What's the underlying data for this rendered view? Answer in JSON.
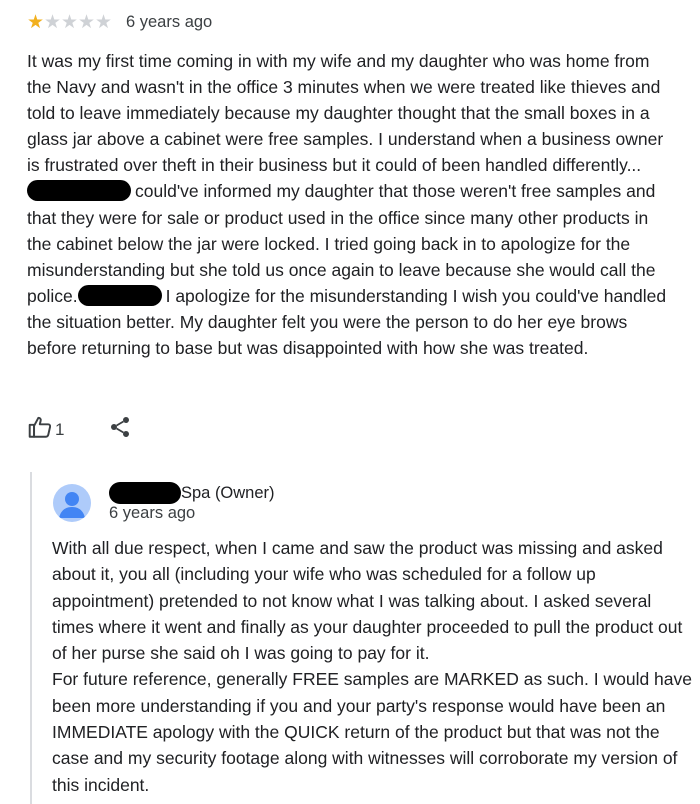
{
  "review": {
    "rating": 1,
    "rating_max": 5,
    "time": "6 years ago",
    "text_part1": "It was my first time coming in with my wife and my daughter who was home from the Navy and wasn't in the office 3 minutes when we were treated like thieves and told to leave immediately because my daughter thought that the small boxes in a glass jar above a cabinet were free samples. I understand when a business owner is frustrated over theft in their business but it could of been handled differently...",
    "text_part2": "could've informed my daughter that those weren't free samples and that they were for sale or product used in the office since many other products in the cabinet below the jar were locked. I tried going back in to apologize for the misunderstanding but she told us once again to leave because she would call the police.",
    "text_part3": "I apologize for the misunderstanding I wish you could've handled the situation better. My daughter felt you were the person to do her eye brows before returning to base but was disappointed with how she was treated."
  },
  "actions": {
    "like_count": "1",
    "like_icon": "thumbs-up-icon",
    "share_icon": "share-icon"
  },
  "owner_response": {
    "name_suffix": "Spa (Owner)",
    "time": "6 years ago",
    "avatar_icon": "person-avatar-icon",
    "text": "With all due respect, when I came and saw the product was missing and asked about it, you all (including your wife who was scheduled for a follow up appointment) pretended to not know what I was talking about. I asked several times where it went and finally as your daughter proceeded to pull the product out of her purse she said oh I was going to pay for it.\nFor future reference, generally FREE samples are MARKED as such. I would have been more understanding if you and your party's response would have been an IMMEDIATE apology with the QUICK return of the product but that was not the case and my security footage along with witnesses will corroborate my version of this incident."
  },
  "colors": {
    "star_filled": "#f2b01e",
    "star_empty": "#cfd2d6",
    "redaction": "#000000",
    "avatar_bg": "#aecbfa",
    "avatar_fg": "#4285f4"
  }
}
